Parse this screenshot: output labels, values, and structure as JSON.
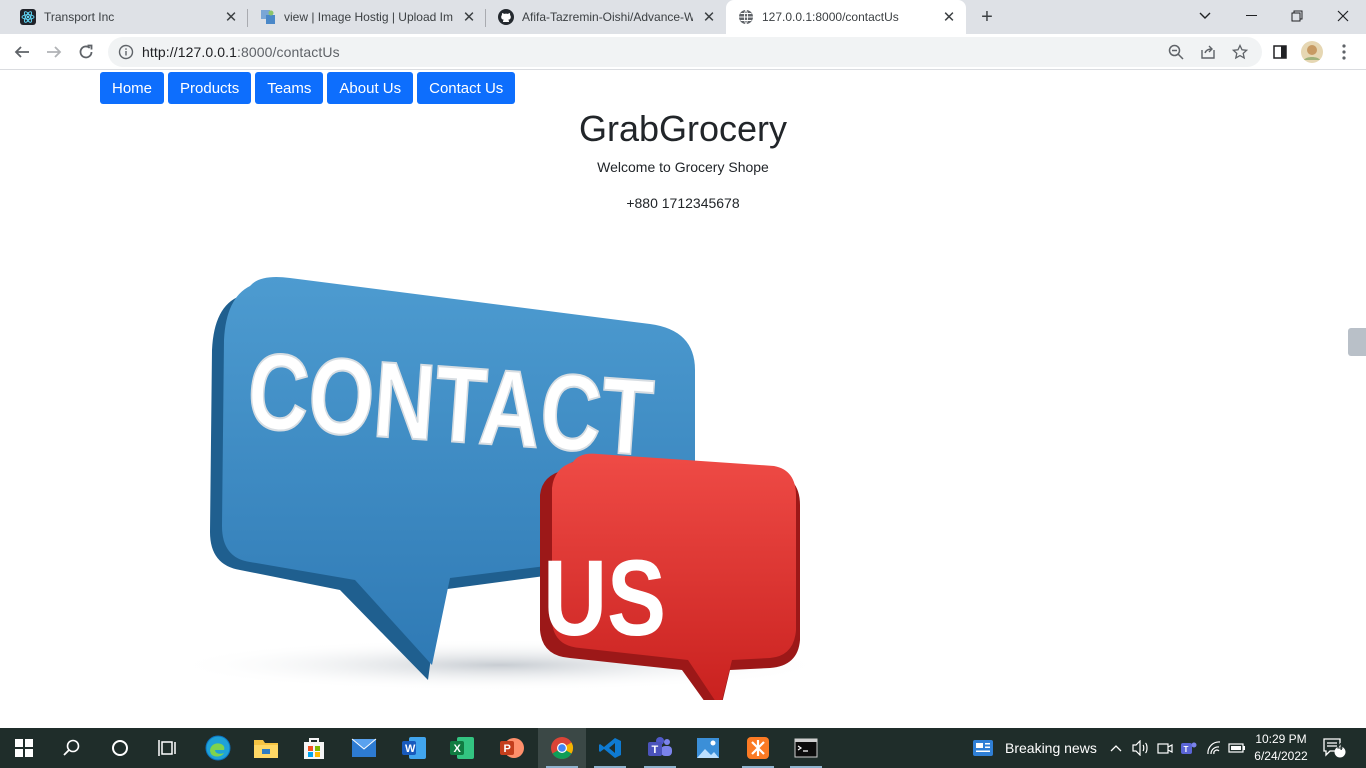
{
  "browser": {
    "tabs": [
      {
        "title": "Transport Inc",
        "icon": "react-icon"
      },
      {
        "title": "view | Image Hostig | Upload Ima",
        "icon": "image-host-icon"
      },
      {
        "title": "Afifa-Tazremin-Oishi/Advance-W",
        "icon": "github-icon"
      },
      {
        "title": "127.0.0.1:8000/contactUs",
        "icon": "globe-icon",
        "active": true
      }
    ],
    "url_host": "http://127.0.0.1",
    "url_path": ":8000/contactUs"
  },
  "page": {
    "nav": [
      "Home",
      "Products",
      "Teams",
      "About Us",
      "Contact Us"
    ],
    "brand": "GrabGrocery",
    "welcome": "Welcome to Grocery Shope",
    "phone": "+880 1712345678",
    "hero": {
      "word1": "CONTACT",
      "word2": "US"
    }
  },
  "taskbar": {
    "news": "Breaking news",
    "time": "10:29 PM",
    "date": "6/24/2022",
    "notifications": "4"
  },
  "colors": {
    "accent": "#0d6efd",
    "bubble_blue": "#3f8fc6",
    "bubble_red": "#e3312f"
  }
}
